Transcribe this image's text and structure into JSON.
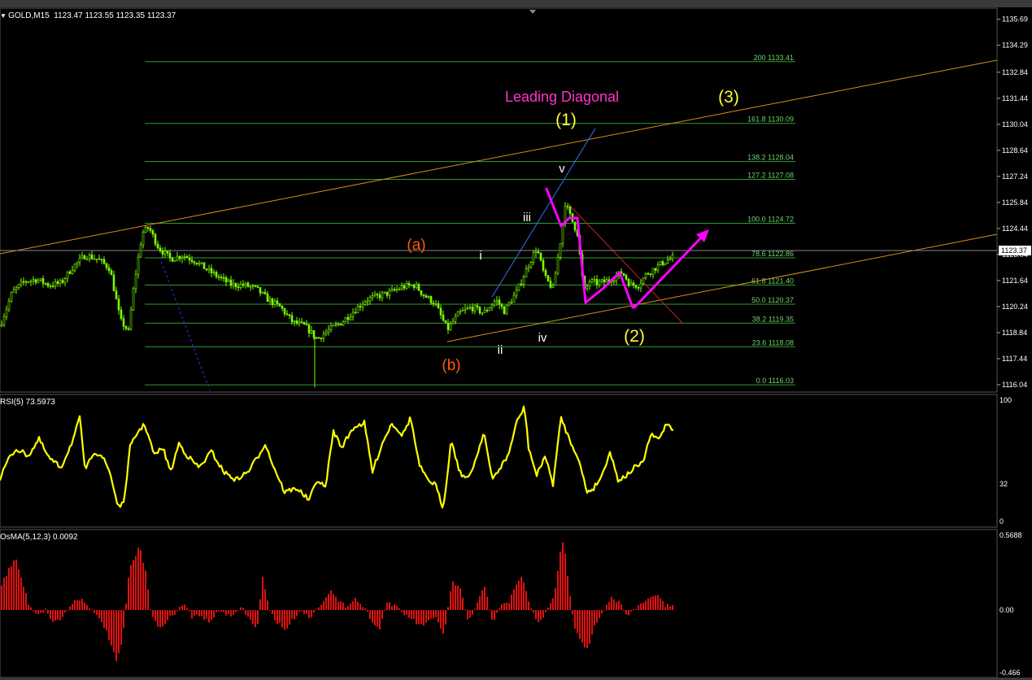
{
  "header": {
    "symbol": "GOLD,M15",
    "ohlc": "1123.47 1123.55 1123.35 1123.37",
    "rsi": "RSI(5) 73.5973",
    "osma": "OsMA(5,12,3) 0.0092"
  },
  "current_price": "1123.37",
  "price_axis": {
    "min": 1115.6,
    "max": 1136.2,
    "ticks": [
      "1135.69",
      "1134.29",
      "1132.84",
      "1131.44",
      "1130.04",
      "1128.64",
      "1127.24",
      "1125.84",
      "1124.44",
      "1123.04",
      "1121.64",
      "1120.24",
      "1118.84",
      "1117.44",
      "1116.04"
    ]
  },
  "fibonacci": {
    "color": "#2e9e2e",
    "levels": [
      {
        "label": "200  1133.41",
        "price": 1133.41
      },
      {
        "label": "161.8  1130.09",
        "price": 1130.09
      },
      {
        "label": "138.2  1128.04",
        "price": 1128.04
      },
      {
        "label": "127.2  1127.08",
        "price": 1127.08
      },
      {
        "label": "100.0  1124.72",
        "price": 1124.72
      },
      {
        "label": "78.6  1122.86",
        "price": 1122.86
      },
      {
        "label": "61.8  1121.40",
        "price": 1121.4
      },
      {
        "label": "50.0  1120.37",
        "price": 1120.37
      },
      {
        "label": "38.2  1119.35",
        "price": 1119.35
      },
      {
        "label": "23.6  1118.08",
        "price": 1118.08
      },
      {
        "label": "0.0  1116.03",
        "price": 1116.03
      }
    ]
  },
  "annotations": {
    "title": "Leading Diagonal",
    "wave_1": "(1)",
    "wave_2": "(2)",
    "wave_3": "(3)",
    "wave_a": "(a)",
    "wave_b": "(b)",
    "sub_i": "i",
    "sub_ii": "ii",
    "sub_iii": "iii",
    "sub_iv": "iv",
    "sub_v": "v"
  },
  "colors": {
    "background": "#000000",
    "bull_candle": "#7cfc00",
    "title": "#ff33cc",
    "wave_major": "#ffff33",
    "wave_ab": "#ff5a00",
    "channel": "#d98c1a",
    "trend_blue": "#3a6cff",
    "rsi_line": "#ffff00",
    "osma_bars": "#e01010",
    "arrows": "#ff00ff"
  },
  "rsi_axis": {
    "ticks": [
      "100",
      "32",
      "0"
    ]
  },
  "osma_axis": {
    "ticks": [
      "0.5688",
      "0.00",
      "-0.466"
    ]
  },
  "chart_data": {
    "type": "candlestick",
    "title": "GOLD,M15",
    "ylim": [
      1115.6,
      1136.2
    ],
    "close_anchors": [
      [
        0,
        1119.2
      ],
      [
        15,
        1121.0
      ],
      [
        30,
        1121.6
      ],
      [
        45,
        1121.7
      ],
      [
        60,
        1121.4
      ],
      [
        75,
        1121.5
      ],
      [
        90,
        1122.4
      ],
      [
        105,
        1123.0
      ],
      [
        120,
        1122.8
      ],
      [
        135,
        1122.3
      ],
      [
        148,
        1119.5
      ],
      [
        158,
        1118.9
      ],
      [
        165,
        1121.5
      ],
      [
        175,
        1124.2
      ],
      [
        183,
        1124.5
      ],
      [
        195,
        1123.4
      ],
      [
        210,
        1122.8
      ],
      [
        225,
        1123.0
      ],
      [
        240,
        1122.7
      ],
      [
        255,
        1122.2
      ],
      [
        270,
        1121.8
      ],
      [
        285,
        1121.4
      ],
      [
        300,
        1121.4
      ],
      [
        315,
        1121.2
      ],
      [
        330,
        1120.6
      ],
      [
        345,
        1120.2
      ],
      [
        360,
        1119.4
      ],
      [
        375,
        1119.2
      ],
      [
        390,
        1118.5
      ],
      [
        405,
        1119.0
      ],
      [
        420,
        1119.4
      ],
      [
        435,
        1120.0
      ],
      [
        450,
        1120.6
      ],
      [
        465,
        1120.8
      ],
      [
        480,
        1121.0
      ],
      [
        495,
        1121.3
      ],
      [
        510,
        1121.4
      ],
      [
        520,
        1120.9
      ],
      [
        535,
        1120.4
      ],
      [
        550,
        1119.0
      ],
      [
        565,
        1119.9
      ],
      [
        580,
        1120.2
      ],
      [
        595,
        1119.9
      ],
      [
        610,
        1120.6
      ],
      [
        620,
        1120.0
      ],
      [
        635,
        1121.0
      ],
      [
        650,
        1122.5
      ],
      [
        660,
        1123.4
      ],
      [
        670,
        1121.8
      ],
      [
        680,
        1121.2
      ],
      [
        690,
        1124.0
      ],
      [
        695,
        1125.8
      ],
      [
        703,
        1124.9
      ],
      [
        710,
        1124.2
      ],
      [
        718,
        1121.0
      ],
      [
        725,
        1121.6
      ],
      [
        735,
        1121.5
      ],
      [
        745,
        1121.6
      ],
      [
        755,
        1121.8
      ],
      [
        765,
        1122.1
      ],
      [
        775,
        1121.4
      ],
      [
        785,
        1121.4
      ],
      [
        795,
        1122.0
      ],
      [
        805,
        1122.3
      ],
      [
        815,
        1122.6
      ],
      [
        828,
        1122.9
      ]
    ],
    "rsi_anchors": [
      [
        0,
        588
      ],
      [
        10,
        565
      ],
      [
        20,
        552
      ],
      [
        35,
        560
      ],
      [
        48,
        540
      ],
      [
        60,
        563
      ],
      [
        75,
        575
      ],
      [
        90,
        540
      ],
      [
        98,
        514
      ],
      [
        105,
        580
      ],
      [
        115,
        555
      ],
      [
        125,
        560
      ],
      [
        135,
        580
      ],
      [
        145,
        622
      ],
      [
        152,
        620
      ],
      [
        160,
        550
      ],
      [
        170,
        530
      ],
      [
        178,
        522
      ],
      [
        190,
        560
      ],
      [
        200,
        550
      ],
      [
        210,
        580
      ],
      [
        220,
        545
      ],
      [
        230,
        560
      ],
      [
        245,
        575
      ],
      [
        260,
        555
      ],
      [
        275,
        580
      ],
      [
        290,
        590
      ],
      [
        305,
        580
      ],
      [
        318,
        560
      ],
      [
        326,
        545
      ],
      [
        335,
        570
      ],
      [
        350,
        605
      ],
      [
        365,
        600
      ],
      [
        380,
        615
      ],
      [
        390,
        590
      ],
      [
        400,
        600
      ],
      [
        410,
        530
      ],
      [
        420,
        550
      ],
      [
        435,
        525
      ],
      [
        448,
        520
      ],
      [
        458,
        580
      ],
      [
        470,
        545
      ],
      [
        482,
        520
      ],
      [
        495,
        535
      ],
      [
        505,
        513
      ],
      [
        515,
        570
      ],
      [
        525,
        590
      ],
      [
        535,
        595
      ],
      [
        545,
        625
      ],
      [
        555,
        540
      ],
      [
        565,
        580
      ],
      [
        575,
        590
      ],
      [
        585,
        565
      ],
      [
        595,
        530
      ],
      [
        605,
        590
      ],
      [
        615,
        575
      ],
      [
        625,
        560
      ],
      [
        635,
        520
      ],
      [
        645,
        500
      ],
      [
        650,
        550
      ],
      [
        660,
        585
      ],
      [
        670,
        560
      ],
      [
        680,
        595
      ],
      [
        690,
        513
      ],
      [
        700,
        540
      ],
      [
        710,
        560
      ],
      [
        722,
        605
      ],
      [
        730,
        600
      ],
      [
        740,
        585
      ],
      [
        750,
        555
      ],
      [
        760,
        590
      ],
      [
        770,
        585
      ],
      [
        780,
        575
      ],
      [
        790,
        570
      ],
      [
        800,
        535
      ],
      [
        810,
        540
      ],
      [
        820,
        520
      ],
      [
        828,
        528
      ]
    ],
    "osma_anchors": [
      [
        0,
        720
      ],
      [
        10,
        700
      ],
      [
        18,
        686
      ],
      [
        25,
        710
      ],
      [
        35,
        745
      ],
      [
        45,
        755
      ],
      [
        55,
        750
      ],
      [
        65,
        765
      ],
      [
        75,
        760
      ],
      [
        85,
        745
      ],
      [
        95,
        735
      ],
      [
        105,
        740
      ],
      [
        115,
        755
      ],
      [
        125,
        765
      ],
      [
        135,
        790
      ],
      [
        142,
        815
      ],
      [
        150,
        785
      ],
      [
        158,
        700
      ],
      [
        165,
        685
      ],
      [
        170,
        672
      ],
      [
        178,
        700
      ],
      [
        185,
        755
      ],
      [
        195,
        775
      ],
      [
        205,
        760
      ],
      [
        215,
        755
      ],
      [
        225,
        740
      ],
      [
        235,
        760
      ],
      [
        245,
        755
      ],
      [
        255,
        765
      ],
      [
        270,
        750
      ],
      [
        285,
        760
      ],
      [
        295,
        745
      ],
      [
        305,
        760
      ],
      [
        315,
        775
      ],
      [
        322,
        710
      ],
      [
        330,
        750
      ],
      [
        340,
        765
      ],
      [
        350,
        775
      ],
      [
        360,
        760
      ],
      [
        370,
        750
      ],
      [
        380,
        760
      ],
      [
        395,
        740
      ],
      [
        405,
        725
      ],
      [
        415,
        740
      ],
      [
        425,
        745
      ],
      [
        435,
        735
      ],
      [
        445,
        745
      ],
      [
        455,
        760
      ],
      [
        465,
        775
      ],
      [
        475,
        740
      ],
      [
        485,
        745
      ],
      [
        495,
        755
      ],
      [
        505,
        760
      ],
      [
        515,
        770
      ],
      [
        525,
        765
      ],
      [
        535,
        760
      ],
      [
        545,
        780
      ],
      [
        555,
        715
      ],
      [
        565,
        725
      ],
      [
        575,
        765
      ],
      [
        585,
        745
      ],
      [
        595,
        720
      ],
      [
        605,
        765
      ],
      [
        615,
        745
      ],
      [
        625,
        740
      ],
      [
        635,
        715
      ],
      [
        642,
        710
      ],
      [
        650,
        745
      ],
      [
        660,
        765
      ],
      [
        670,
        755
      ],
      [
        680,
        735
      ],
      [
        688,
        680
      ],
      [
        692,
        660
      ],
      [
        698,
        715
      ],
      [
        705,
        770
      ],
      [
        715,
        790
      ],
      [
        722,
        800
      ],
      [
        730,
        770
      ],
      [
        740,
        755
      ],
      [
        750,
        735
      ],
      [
        760,
        740
      ],
      [
        770,
        755
      ],
      [
        780,
        750
      ],
      [
        790,
        740
      ],
      [
        800,
        735
      ],
      [
        808,
        730
      ],
      [
        816,
        745
      ],
      [
        828,
        745
      ]
    ]
  }
}
